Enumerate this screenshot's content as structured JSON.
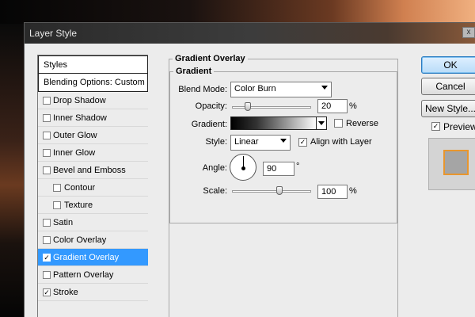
{
  "window": {
    "title": "Layer Style",
    "close_glyph": "x"
  },
  "styles_list": {
    "header": "Styles",
    "blending_options": "Blending Options: Custom",
    "items": [
      {
        "label": "Drop Shadow",
        "checked": false,
        "check_glyph": ""
      },
      {
        "label": "Inner Shadow",
        "checked": false,
        "check_glyph": ""
      },
      {
        "label": "Outer Glow",
        "checked": false,
        "check_glyph": ""
      },
      {
        "label": "Inner Glow",
        "checked": false,
        "check_glyph": ""
      },
      {
        "label": "Bevel and Emboss",
        "checked": false,
        "check_glyph": ""
      },
      {
        "label": "Contour",
        "checked": false,
        "check_glyph": ""
      },
      {
        "label": "Texture",
        "checked": false,
        "check_glyph": ""
      },
      {
        "label": "Satin",
        "checked": false,
        "check_glyph": ""
      },
      {
        "label": "Color Overlay",
        "checked": false,
        "check_glyph": ""
      },
      {
        "label": "Gradient Overlay",
        "checked": true,
        "check_glyph": "✓",
        "selected": true
      },
      {
        "label": "Pattern Overlay",
        "checked": false,
        "check_glyph": ""
      },
      {
        "label": "Stroke",
        "checked": true,
        "check_glyph": "✓"
      }
    ]
  },
  "panel": {
    "title": "Gradient Overlay",
    "group_title": "Gradient",
    "blend_mode": {
      "label": "Blend Mode:",
      "value": "Color Burn"
    },
    "opacity": {
      "label": "Opacity:",
      "value": "20",
      "unit": "%",
      "slider_fraction": 0.2
    },
    "gradient": {
      "label": "Gradient:",
      "reverse_label": "Reverse",
      "reverse_checked": false
    },
    "style": {
      "label": "Style:",
      "value": "Linear",
      "align_label": "Align with Layer",
      "align_checked": true,
      "align_glyph": "✓"
    },
    "angle": {
      "label": "Angle:",
      "value": "90",
      "unit": "°"
    },
    "scale": {
      "label": "Scale:",
      "value": "100",
      "unit": "%",
      "slider_fraction": 0.6
    }
  },
  "buttons": {
    "ok": "OK",
    "cancel": "Cancel",
    "new_style": "New Style...",
    "preview_label": "Preview",
    "preview_checked": true,
    "preview_glyph": "✓"
  },
  "colors": {
    "selection": "#3399ff",
    "dialog_bg": "#ececec",
    "preview_swatch": "#a5a5a5",
    "preview_border": "#e8962e"
  }
}
